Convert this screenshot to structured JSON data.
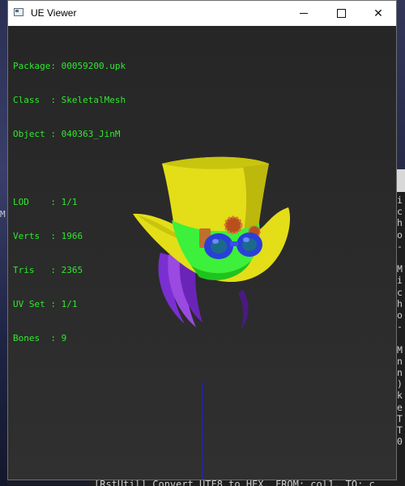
{
  "window": {
    "title": "UE Viewer",
    "controls": {
      "minimize_icon": "minimize-icon",
      "maximize_icon": "maximize-icon",
      "close_icon": "close-icon",
      "close_glyph": "✕"
    }
  },
  "info": {
    "package_label": "Package:",
    "package_value": "00059200.upk",
    "class_label": "Class  :",
    "class_value": "SkeletalMesh",
    "object_label": "Object :",
    "object_value": "040363_JinM",
    "lod_label": "LOD    :",
    "lod_value": "1/1",
    "verts_label": "Verts  :",
    "verts_value": "1966",
    "tris_label": "Tris   :",
    "tris_value": "2365",
    "uvset_label": "UV Set :",
    "uvset_value": "1/1",
    "bones_label": "Bones  :",
    "bones_value": "9"
  },
  "background": {
    "left_letter": "M",
    "console_right_lines": [
      "i",
      "c",
      "h",
      "o",
      "-",
      "",
      "M",
      "i",
      "c",
      "h",
      "o",
      "-",
      "",
      "M",
      "n",
      "n",
      ")",
      "k",
      "e",
      "T",
      "T",
      "0"
    ],
    "console_bottom": "[RstUtil] Convert UTF8 to HEX, FROM: col1, TO: c"
  },
  "colors": {
    "info_text": "#2fe82f",
    "hat_yellow": "#e3de17",
    "band_green": "#3cf03c",
    "goggle_blue": "#2a3fd8",
    "hair_purple": "#8a3ad8",
    "axis_blue": "#1f1fcf"
  }
}
